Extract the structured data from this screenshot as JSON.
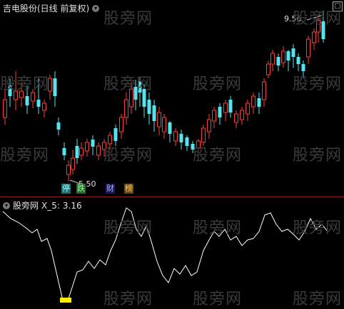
{
  "main": {
    "title": "吉电股份(日线 前复权)",
    "high_label": "9.56",
    "low_label": "5.50",
    "tags": [
      {
        "text": "停",
        "bg": "#1f6f6f",
        "fg": "#9ff"
      },
      {
        "text": "跌",
        "bg": "#2a6a2a",
        "fg": "#9f9"
      },
      {
        "text": "财",
        "bg": "#1a1a55",
        "fg": "#aaf"
      },
      {
        "text": "榜",
        "bg": "#6a4a1a",
        "fg": "#fc6"
      }
    ]
  },
  "indicator": {
    "name": "股旁网",
    "series_label": "X_5:",
    "series_value": "3.16"
  },
  "watermark": "股旁网",
  "colors": {
    "up": "#ff3b3b",
    "down": "#54e4f0",
    "line": "#ffffff",
    "marker": "#ffee00"
  }
}
